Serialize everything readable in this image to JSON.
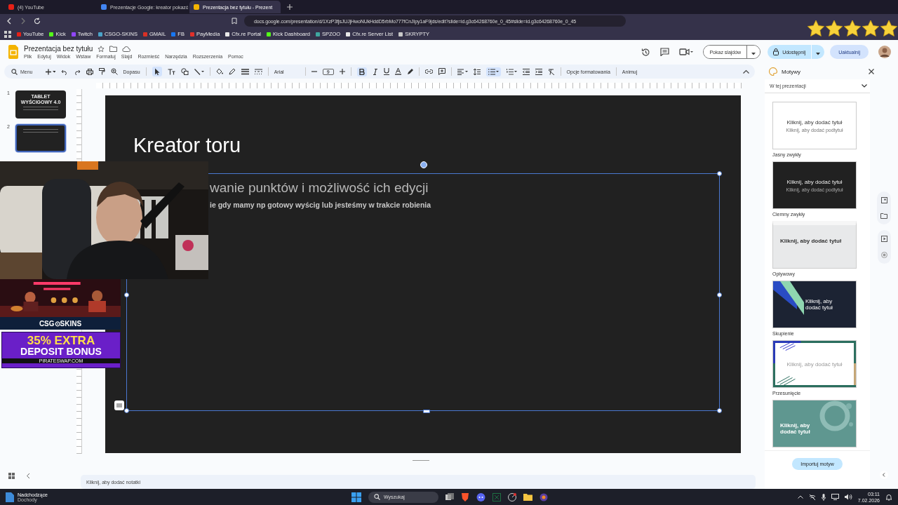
{
  "browser": {
    "tabs": [
      {
        "label": "(4) YouTube",
        "selected": false,
        "color": "#e62117"
      },
      {
        "label": "Prezentacje Google: kreator pokazó",
        "selected": false,
        "color": "#4285f4"
      },
      {
        "label": "Prezentacja bez tytułu - Prezent",
        "selected": true,
        "color": "#f4b400"
      }
    ],
    "url": "docs.google.com/presentation/d/1XzP3fjsJUJjHwoNUkHddD5rbMo777fCnJIpy1aF9jds/edit?slide=id.g3c64268760e_0_45#slide=id.g3c64268760e_0_45",
    "bookmarks": [
      {
        "label": "YouTube",
        "color": "#e62117"
      },
      {
        "label": "Kick",
        "color": "#53fc18"
      },
      {
        "label": "Twitch",
        "color": "#9146ff"
      },
      {
        "label": "CSGO-SKINS",
        "color": "#4aa3c8"
      },
      {
        "label": "GMAIL",
        "color": "#d93025"
      },
      {
        "label": "FB",
        "color": "#1877f2"
      },
      {
        "label": "PayMedia",
        "color": "#e0302a"
      },
      {
        "label": "Cfx.re Portal",
        "color": "#e8e8e8"
      },
      {
        "label": "Kick Dashboard",
        "color": "#53fc18"
      },
      {
        "label": "SPZOO",
        "color": "#3fa7a0"
      },
      {
        "label": "Cfx.re Server List",
        "color": "#e8e8e8"
      },
      {
        "label": "SKRYPTY",
        "color": "#c8c8c8"
      }
    ]
  },
  "docs": {
    "title": "Prezentacja bez tytułu",
    "menu": [
      "Plik",
      "Edytuj",
      "Widok",
      "Wstaw",
      "Formatuj",
      "Slajd",
      "Rozmieść",
      "Narzędzia",
      "Rozszerzenia",
      "Pomoc"
    ],
    "slideshow_button": "Pokaz slajdów",
    "share_button": "Udostępnij",
    "upgrade_button": "Uaktualnij"
  },
  "toolbar": {
    "search": "Menu",
    "zoom": "Dopasu",
    "font": "Arial",
    "font_size": "9",
    "bold_active": true,
    "format_options": "Opcje formatowania",
    "animate": "Animuj"
  },
  "filmstrip": [
    {
      "number": "1",
      "title": "TABLET WYŚCIGOWY 4.0",
      "selected": false
    },
    {
      "number": "2",
      "selected": true
    }
  ],
  "slide": {
    "title": "Kreator toru",
    "heading": "wanie punktów i możliwość ich edycji",
    "body": "ie gdy mamy np gotowy wyścig lub jesteśmy w trakcie robienia"
  },
  "themes": {
    "title": "Motywy",
    "filter": "W tej prezentacji",
    "items": [
      {
        "kind": "light",
        "name": "Jasny zwykły",
        "preview_title": "Kliknij, aby dodać tytuł",
        "preview_subtitle": "Kliknij, aby dodać podtytuł"
      },
      {
        "kind": "dark",
        "name": "Ciemny zwykły",
        "preview_title": "Kliknij, aby dodać tytuł",
        "preview_subtitle": "Kliknij, aby dodać podtytuł"
      },
      {
        "kind": "streamline",
        "name": "Opływowy",
        "preview_title": "Kliknij, aby dodać tytuł"
      },
      {
        "kind": "focus",
        "name": "Skupienie",
        "preview_title": "Kliknij, aby dodać tytuł"
      },
      {
        "kind": "shift",
        "name": "Przesunięcie",
        "preview_title": "Kliknij, aby dodać tytuł"
      },
      {
        "kind": "teal",
        "preview_title": "Kliknij, aby dodać tytuł"
      }
    ],
    "import_button": "Importuj motyw"
  },
  "notes": {
    "placeholder": "Kliknij, aby dodać notatki"
  },
  "stream_overlay": {
    "sponsor": "CSG⊙SKINS",
    "ad_line_1": "35% EXTRA",
    "ad_line_2": "DEPOSIT BONUS",
    "ad_site": "PIRATESWAP.COM"
  },
  "taskbar": {
    "weather_title": "Nadchodzące",
    "weather_subtitle": "Dochody",
    "search": "Wyszukaj",
    "time": "03:11",
    "date": "7.02.2026"
  }
}
